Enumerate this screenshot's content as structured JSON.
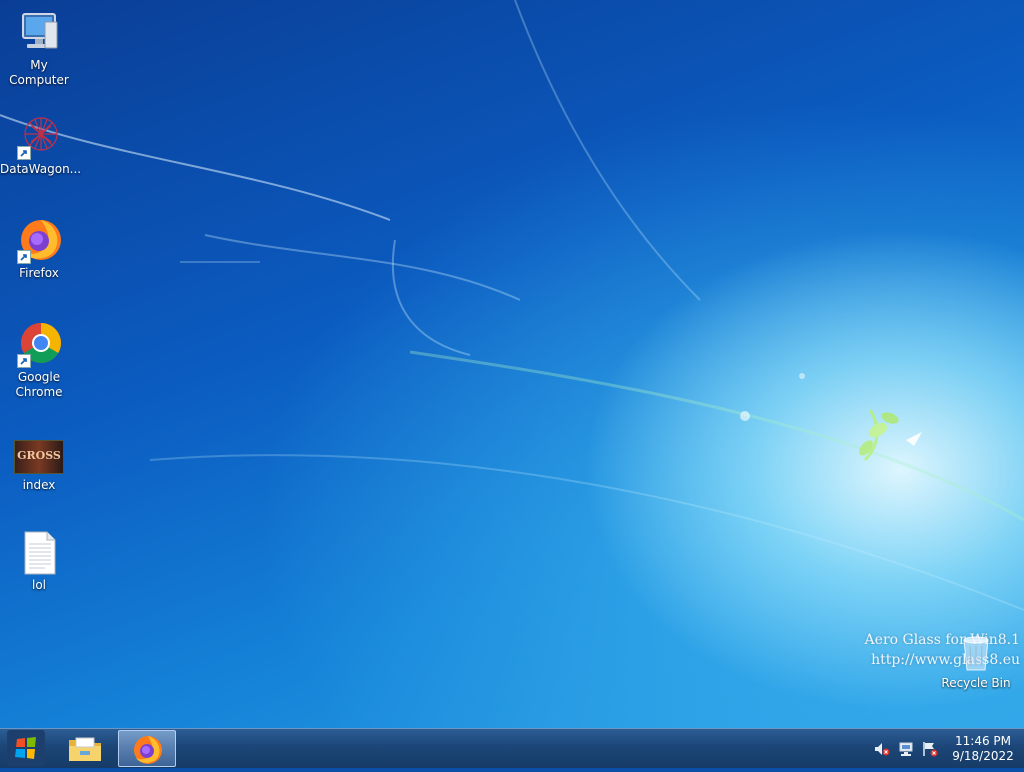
{
  "desktop": {
    "icons": [
      {
        "label": "My Computer"
      },
      {
        "label": "DataWagon..."
      },
      {
        "label": "Firefox"
      },
      {
        "label": "Google Chrome"
      },
      {
        "label": "index",
        "thumb_text": "GROSS"
      },
      {
        "label": "lol"
      },
      {
        "label": "Recycle Bin"
      }
    ],
    "watermark": {
      "line1": "Aero Glass for Win8.1",
      "line2": "http://www.glass8.eu"
    }
  },
  "taskbar": {
    "pinned": [
      {
        "icon": "start-orb-icon"
      },
      {
        "icon": "file-explorer-icon"
      },
      {
        "icon": "firefox-icon",
        "active": true
      }
    ],
    "tray_icons": [
      "volume-muted-icon",
      "network-icon",
      "action-center-flag-icon"
    ],
    "clock": {
      "time": "11:46 PM",
      "date": "9/18/2022"
    }
  },
  "colors": {
    "taskbar": "#1c4678",
    "desktop_accent": "#1583d8"
  }
}
